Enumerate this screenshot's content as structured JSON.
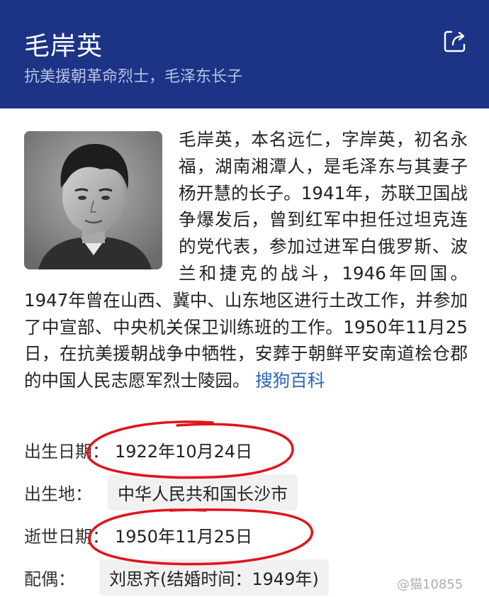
{
  "header": {
    "title": "毛岸英",
    "subtitle": "抗美援朝革命烈士，毛泽东长子",
    "share_icon": "share-icon"
  },
  "intro": {
    "text": "毛岸英，本名远仁，字岸英，初名永福，湖南湘潭人，是毛泽东与其妻子杨开慧的长子。1941年，苏联卫国战争爆发后，曾到红军中担任过坦克连的党代表，参加过进军白俄罗斯、波兰和捷克的战斗，1946年回国。1947年曾在山西、冀中、山东地区进行土改工作，并参加了中宣部、中央机关保卫训练班的工作。1950年11月25日，在抗美援朝战争中牺牲，安葬于朝鲜平安南道桧仓郡的中国人民志愿军烈士陵园。",
    "source": "搜狗百科"
  },
  "info": {
    "birth_date_label": "出生日期：",
    "birth_date": "1922年10月24日",
    "birthplace_label": "出生地：",
    "birthplace": "中华人民共和国长沙市",
    "death_date_label": "逝世日期：",
    "death_date": "1950年11月25日",
    "spouse_label": "配偶：",
    "spouse": "刘思齐(结婚时间：1949年)"
  },
  "watermark": "@猫10855",
  "colors": {
    "header_bg": "#1c3386",
    "link": "#2d63b5",
    "annotation": "#e0141e"
  }
}
